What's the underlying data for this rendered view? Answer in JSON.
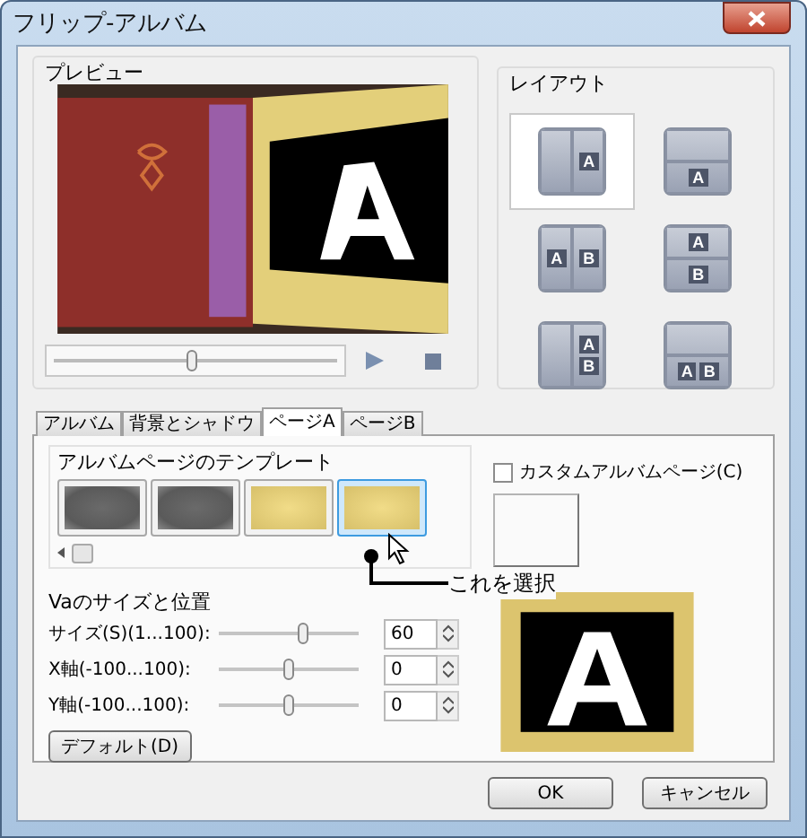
{
  "window": {
    "title": "フリップ-アルバム"
  },
  "preview": {
    "label": "プレビュー",
    "timeline": {
      "level": 0.49
    }
  },
  "layout": {
    "label": "レイアウト",
    "items": [
      {
        "kind": "side",
        "labels": [
          "A"
        ],
        "selected": true
      },
      {
        "kind": "stack",
        "labels": [
          "A"
        ],
        "selected": false
      },
      {
        "kind": "side",
        "labels": [
          "A",
          "B"
        ],
        "selected": false
      },
      {
        "kind": "stack",
        "labels": [
          "A",
          "B"
        ],
        "selected": false
      },
      {
        "kind": "side-stack",
        "labels": [
          "A",
          "B"
        ],
        "selected": false
      },
      {
        "kind": "stack-side",
        "labels": [
          "A",
          "B"
        ],
        "selected": false
      }
    ]
  },
  "tabs": [
    {
      "label": "アルバム",
      "selected": false
    },
    {
      "label": "背景とシャドウ",
      "selected": false
    },
    {
      "label": "ページA",
      "selected": true
    },
    {
      "label": "ページB",
      "selected": false
    }
  ],
  "templates": {
    "label": "アルバムページのテンプレート",
    "items": [
      {
        "kind": "grey",
        "selected": false
      },
      {
        "kind": "grey",
        "selected": false
      },
      {
        "kind": "gold",
        "selected": false
      },
      {
        "kind": "gold",
        "selected": true
      }
    ]
  },
  "annotation": "これを選択",
  "custom_page": {
    "label": "カスタムアルバムページ(C)",
    "checked": false
  },
  "size_position": {
    "label": "Vaのサイズと位置",
    "rows": [
      {
        "label": "サイズ(S)(1...100):",
        "level": 0.6,
        "value": "60"
      },
      {
        "label": "X軸(-100...100):",
        "level": 0.5,
        "value": "0"
      },
      {
        "label": "Y軸(-100...100):",
        "level": 0.5,
        "value": "0"
      }
    ],
    "default_button": "デフォルト(D)"
  },
  "buttons": [
    "OK",
    "キャンセル"
  ]
}
